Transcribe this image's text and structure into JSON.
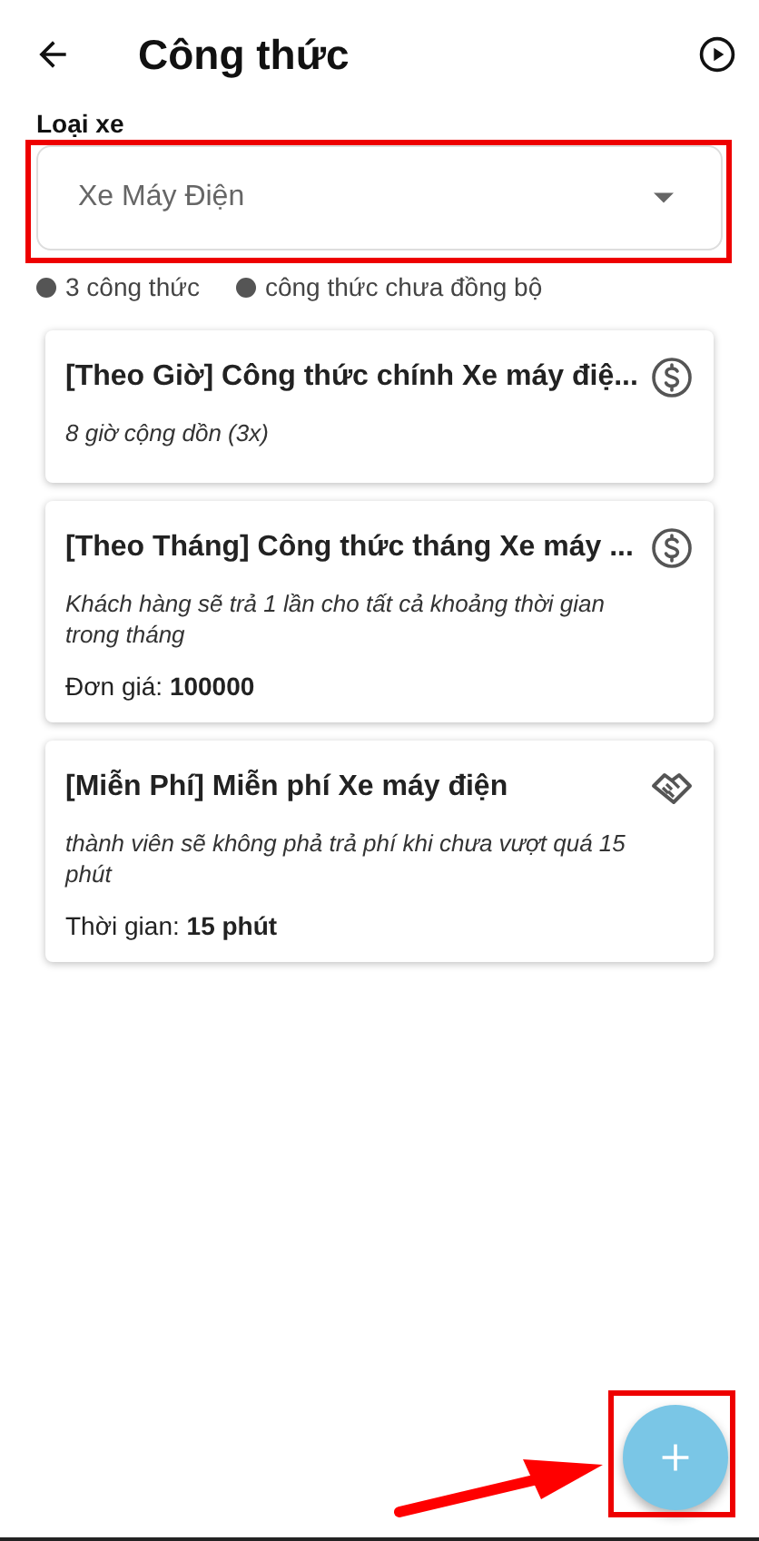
{
  "header": {
    "title": "Công thức"
  },
  "vehicle_select": {
    "label": "Loại xe",
    "value": "Xe Máy Điện"
  },
  "legend": [
    "3 công thức",
    "công thức chưa đồng bộ"
  ],
  "formulas": [
    {
      "title": "[Theo Giờ] Công thức chính Xe máy điệ...",
      "kind": "paid",
      "description": "8 giờ cộng dồn (3x)"
    },
    {
      "title": "[Theo Tháng] Công thức tháng Xe máy ...",
      "kind": "paid",
      "description": "Khách hàng sẽ trả 1 lần cho tất cả khoảng thời gian trong tháng",
      "detail": "Đơn giá: **100000**"
    },
    {
      "title": "[Miễn Phí] Miễn phí Xe máy điện",
      "kind": "free",
      "description": "thành viên sẽ không phả trả phí khi chưa vượt quá 15 phút",
      "detail": "Thời gian: **15 phút**"
    }
  ]
}
